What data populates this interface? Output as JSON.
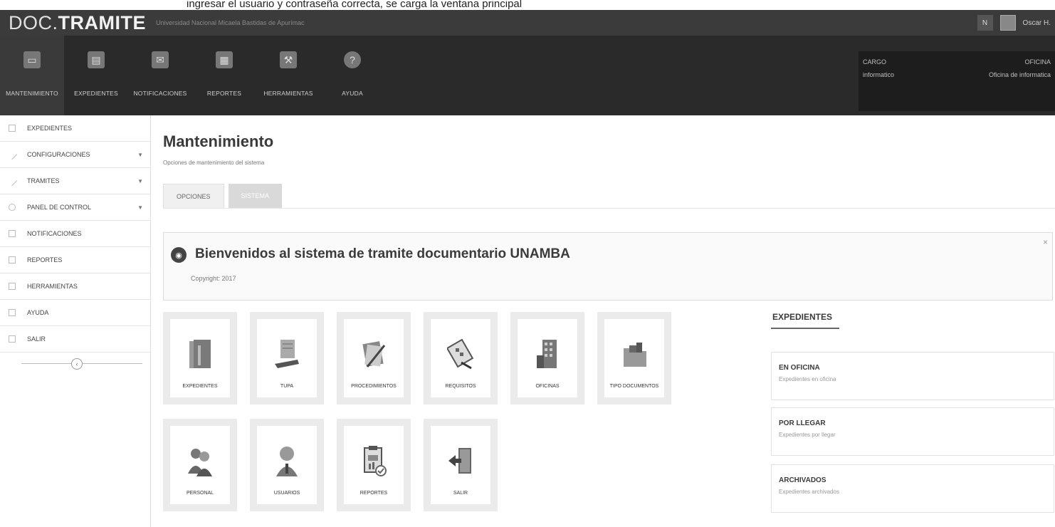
{
  "caption": "ingresar el usuario y contraseña correcta, se carga la ventana principal",
  "app": {
    "brand_prefix": "DOC.",
    "brand_main": "TRAMITE",
    "brand_subtitle": "Universidad Nacional Micaela Bastidas de Apurímac",
    "badge": "N",
    "user_name": "Oscar H."
  },
  "ribbon": {
    "tabs": [
      {
        "label": "MANTENIMIENTO",
        "icon": "monitor-icon"
      },
      {
        "label": "EXPEDIENTES",
        "icon": "document-icon"
      },
      {
        "label": "NOTIFICACIONES",
        "icon": "mail-icon"
      },
      {
        "label": "REPORTES",
        "icon": "report-icon"
      },
      {
        "label": "HERRAMIENTAS",
        "icon": "wrench-icon"
      },
      {
        "label": "AYUDA",
        "icon": "help-icon"
      }
    ],
    "info": {
      "cargo_label": "CARGO",
      "oficina_label": "OFICINA",
      "cargo_value": "informatico",
      "oficina_value": "Oficina de informatica"
    }
  },
  "sidebar": {
    "items": [
      {
        "label": "EXPEDIENTES",
        "has_arrow": false
      },
      {
        "label": "CONFIGURACIONES",
        "has_arrow": true
      },
      {
        "label": "TRAMITES",
        "has_arrow": true
      },
      {
        "label": "PANEL DE CONTROL",
        "has_arrow": true
      },
      {
        "label": "NOTIFICACIONES",
        "has_arrow": false
      },
      {
        "label": "REPORTES",
        "has_arrow": false
      },
      {
        "label": "HERRAMIENTAS",
        "has_arrow": false
      },
      {
        "label": "AYUDA",
        "has_arrow": false
      },
      {
        "label": "SALIR",
        "has_arrow": false
      }
    ],
    "arrow_glyph": "▼",
    "collapse_glyph": "‹"
  },
  "main": {
    "title": "Mantenimiento",
    "subtitle": "Opciones de mantenimiento del sistema",
    "tabs": [
      "OPCIONES",
      "SISTEMA"
    ],
    "welcome": {
      "title": "Bienvenidos al sistema de tramite documentario UNAMBA",
      "copyright": "Copyright: 2017",
      "close": "×"
    },
    "tiles": [
      {
        "label": "EXPEDIENTES",
        "icon": "folder-binder-icon",
        "color": "#8a8a8a"
      },
      {
        "label": "TUPA",
        "icon": "book-icon",
        "color": "#6e6e6e"
      },
      {
        "label": "PROCEDIMIENTOS",
        "icon": "clipboard-pen-icon",
        "color": "#7c7c7c"
      },
      {
        "label": "REQUISITOS",
        "icon": "checklist-icon",
        "color": "#777777"
      },
      {
        "label": "OFICINAS",
        "icon": "building-icon",
        "color": "#6a6a6a"
      },
      {
        "label": "TIPO DOCUMENTOS",
        "icon": "folder-icon",
        "color": "#909090"
      },
      {
        "label": "PERSONAL",
        "icon": "people-icon",
        "color": "#777777"
      },
      {
        "label": "USUARIOS",
        "icon": "user-icon",
        "color": "#8c8c8c"
      },
      {
        "label": "REPORTES",
        "icon": "report-check-icon",
        "color": "#707070"
      },
      {
        "label": "SALIR",
        "icon": "exit-door-icon",
        "color": "#6e6e6e"
      }
    ],
    "expedientes": {
      "heading": "EXPEDIENTES",
      "cards": [
        {
          "title": "EN OFICINA",
          "subtitle": "Expedientes en oficina"
        },
        {
          "title": "POR LLEGAR",
          "subtitle": "Expedientes por llegar"
        },
        {
          "title": "ARCHIVADOS",
          "subtitle": "Expedientes archivados"
        }
      ]
    }
  }
}
